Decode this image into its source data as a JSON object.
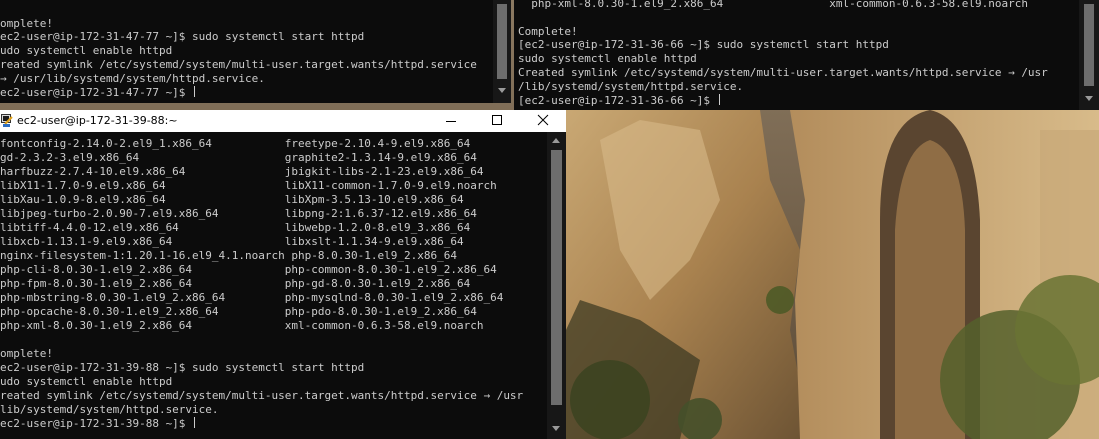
{
  "terminals": {
    "top_left": {
      "lines": [
        "omplete!",
        "ec2-user@ip-172-31-47-77 ~]$ sudo systemctl start httpd",
        "udo systemctl enable httpd",
        "reated symlink /etc/systemd/system/multi-user.target.wants/httpd.service",
        "→ /usr/lib/systemd/system/httpd.service.",
        "ec2-user@ip-172-31-47-77 ~]$ "
      ]
    },
    "top_right": {
      "lines": [
        "  php-xml-8.0.30-1.el9_2.x86_64                xml-common-0.6.3-58.el9.noarch",
        "",
        "Complete!",
        "[ec2-user@ip-172-31-36-66 ~]$ sudo systemctl start httpd",
        "sudo systemctl enable httpd",
        "Created symlink /etc/systemd/system/multi-user.target.wants/httpd.service → /usr",
        "/lib/systemd/system/httpd.service.",
        "[ec2-user@ip-172-31-36-66 ~]$ "
      ]
    },
    "main": {
      "title": "ec2-user@ip-172-31-39-88:~",
      "lines": [
        "fontconfig-2.14.0-2.el9_1.x86_64           freetype-2.10.4-9.el9.x86_64",
        "gd-2.3.2-3.el9.x86_64                      graphite2-1.3.14-9.el9.x86_64",
        "harfbuzz-2.7.4-10.el9.x86_64               jbigkit-libs-2.1-23.el9.x86_64",
        "libX11-1.7.0-9.el9.x86_64                  libX11-common-1.7.0-9.el9.noarch",
        "libXau-1.0.9-8.el9.x86_64                  libXpm-3.5.13-10.el9.x86_64",
        "libjpeg-turbo-2.0.90-7.el9.x86_64          libpng-2:1.6.37-12.el9.x86_64",
        "libtiff-4.4.0-12.el9.x86_64                libwebp-1.2.0-8.el9_3.x86_64",
        "libxcb-1.13.1-9.el9.x86_64                 libxslt-1.1.34-9.el9.x86_64",
        "nginx-filesystem-1:1.20.1-16.el9_4.1.noarch php-8.0.30-1.el9_2.x86_64",
        "php-cli-8.0.30-1.el9_2.x86_64              php-common-8.0.30-1.el9_2.x86_64",
        "php-fpm-8.0.30-1.el9_2.x86_64              php-gd-8.0.30-1.el9_2.x86_64",
        "php-mbstring-8.0.30-1.el9_2.x86_64         php-mysqlnd-8.0.30-1.el9_2.x86_64",
        "php-opcache-8.0.30-1.el9_2.x86_64          php-pdo-8.0.30-1.el9_2.x86_64",
        "php-xml-8.0.30-1.el9_2.x86_64              xml-common-0.6.3-58.el9.noarch",
        "",
        "omplete!",
        "ec2-user@ip-172-31-39-88 ~]$ sudo systemctl start httpd",
        "udo systemctl enable httpd",
        "reated symlink /etc/systemd/system/multi-user.target.wants/httpd.service → /usr",
        "lib/systemd/system/httpd.service.",
        "ec2-user@ip-172-31-39-88 ~]$ "
      ]
    }
  },
  "colors": {
    "terminal_bg": "#0c0c0c",
    "terminal_fg": "#cccccc",
    "titlebar_bg": "#ffffff",
    "scrollbar_track": "#171717",
    "scrollbar_thumb": "#6d6d6d"
  },
  "icons": {
    "putty": "putty-icon",
    "minimize": "minimize-icon",
    "maximize": "maximize-icon",
    "close": "close-icon"
  }
}
